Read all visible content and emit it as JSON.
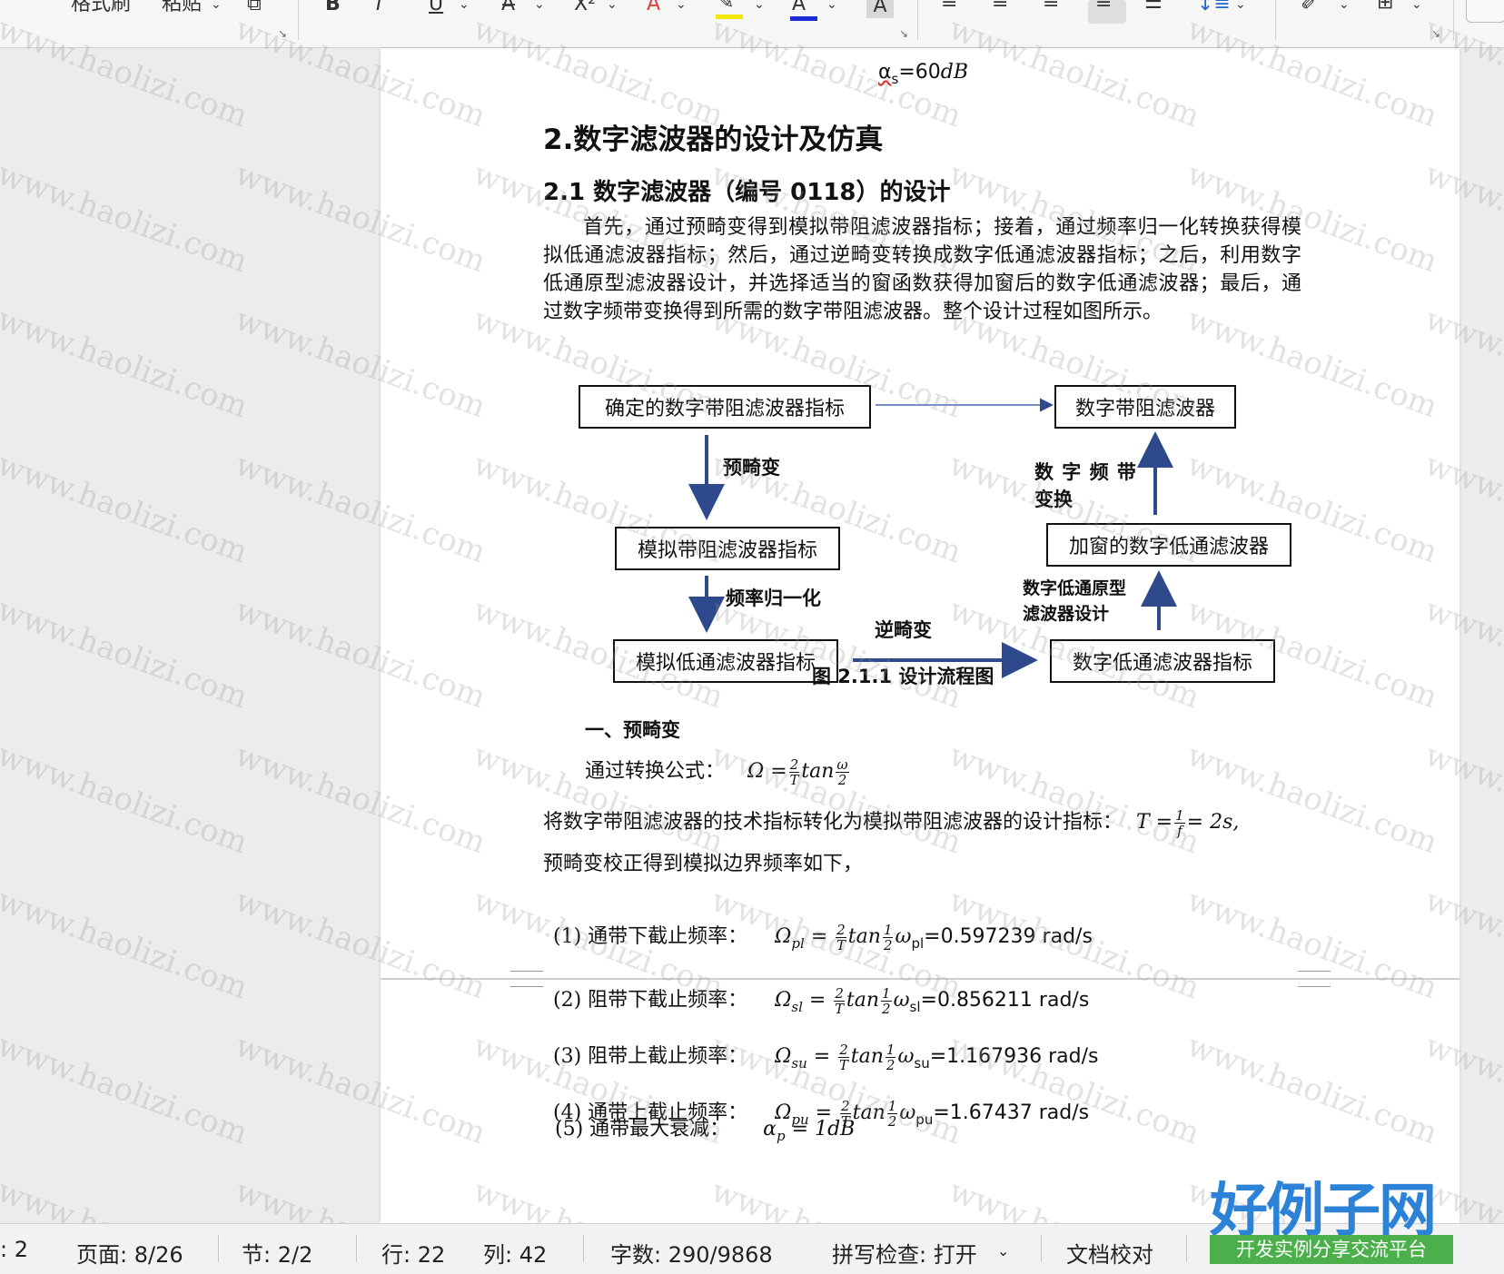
{
  "toolbar": {
    "format_painter": "格式刷",
    "paste": "粘贴",
    "bold": "B",
    "italic": "I",
    "underline": "U",
    "strike": "A̶",
    "superscript": "X²",
    "font_color_a": "A",
    "char_shade": "A",
    "highlight_color": "#f2e600",
    "font_color": "#1a2bd6"
  },
  "doc": {
    "top_formula": "α",
    "top_formula_sub": "s",
    "top_formula_rest": "=60",
    "top_formula_unit": "dB",
    "h1": "2.数字滤波器的设计及仿真",
    "h2": "2.1 数字滤波器（编号 0118）的设计",
    "para": "首先，通过预畸变得到模拟带阻滤波器指标；接着，通过频率归一化转换获得模拟低通滤波器指标；然后，通过逆畸变转换成数字低通滤波器指标；之后，利用数字低通原型滤波器设计，并选择适当的窗函数获得加窗后的数字低通滤波器；最后，通过数字频带变换得到所需的数字带阻滤波器。整个设计过程如图所示。",
    "flow": {
      "box1": "确定的数字带阻滤波器指标",
      "box2": "数字带阻滤波器",
      "box3": "模拟带阻滤波器指标",
      "box4": "加窗的数字低通滤波器",
      "box5": "模拟低通滤波器指标",
      "box6": "数字低通滤波器指标",
      "lbl_predistort": "预畸变",
      "lbl_norm": "频率归一化",
      "lbl_inverse": "逆畸变",
      "lbl_bandxform_1": "数 字 频 带",
      "lbl_bandxform_2": "变换",
      "lbl_proto_1": "数字低通原型",
      "lbl_proto_2": "滤波器设计"
    },
    "caption": "图 2.1.1  设计流程图",
    "sec1": "一、预畸变",
    "formula_intro": "通过转换公式：",
    "formula_main": "Ω =",
    "formula_tan": "tan",
    "para2": "将数字带阻滤波器的技术指标转化为模拟带阻滤波器的设计指标：",
    "para2_formula": "T =",
    "para2_formula_tail": "= 2s,",
    "para3": "预畸变校正得到模拟边界频率如下，",
    "freqs": [
      {
        "label": "(1) 通带下截止频率：",
        "sym": "Ω",
        "sub": "pl",
        "wsub": "pl",
        "value": "=0.597239 rad/s"
      },
      {
        "label": "(2) 阻带下截止频率：",
        "sym": "Ω",
        "sub": "sl",
        "wsub": "sl",
        "value": "=0.856211 rad/s"
      },
      {
        "label": "(3) 阻带上截止频率：",
        "sym": "Ω",
        "sub": "su",
        "wsub": "su",
        "value": "=1.167936 rad/s"
      },
      {
        "label": "(4) 通带上截止频率：",
        "sym": "Ω",
        "sub": "pu",
        "wsub": "pu",
        "value": "=1.67437 rad/s"
      }
    ],
    "item5_label": "(5)  通带最大衰减：",
    "item5_formula": "α",
    "item5_sub": "p",
    "item5_value": "= 1dB"
  },
  "status": {
    "sections_partial": ": 2",
    "page": "页面: 8/26",
    "section": "节: 2/2",
    "row": "行: 22",
    "col": "列: 42",
    "words": "字数: 290/9868",
    "spell": "拼写检查: 打开",
    "proof": "文档校对"
  },
  "watermark": "www.haolizi.com",
  "logo": {
    "title": "好例子网",
    "subtitle": "开发实例分享交流平台"
  }
}
